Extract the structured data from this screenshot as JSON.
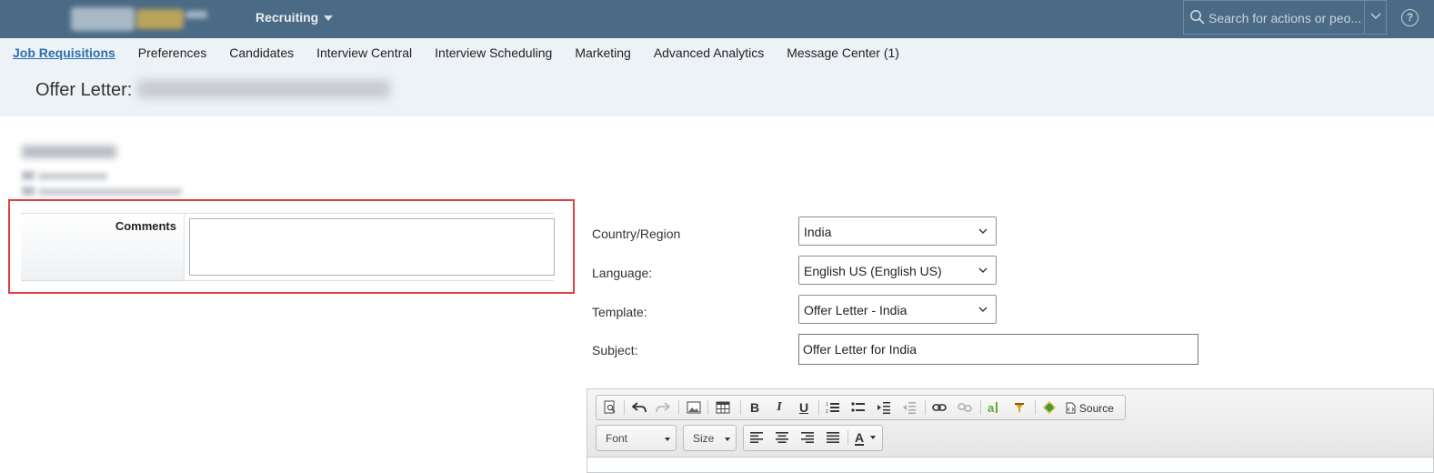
{
  "shell": {
    "module": "Recruiting",
    "search_placeholder": "Search for actions or peo...",
    "help_glyph": "?"
  },
  "tabs": [
    {
      "label": "Job Requisitions",
      "active": true
    },
    {
      "label": "Preferences",
      "active": false
    },
    {
      "label": "Candidates",
      "active": false
    },
    {
      "label": "Interview Central",
      "active": false
    },
    {
      "label": "Interview Scheduling",
      "active": false
    },
    {
      "label": "Marketing",
      "active": false
    },
    {
      "label": "Advanced Analytics",
      "active": false
    },
    {
      "label": "Message Center (1)",
      "active": false
    }
  ],
  "page": {
    "title_prefix": "Offer Letter:"
  },
  "comments": {
    "label": "Comments",
    "value": ""
  },
  "form": {
    "country_label": "Country/Region",
    "country_value": "India",
    "language_label": "Language:",
    "language_value": "English US (English US)",
    "template_label": "Template:",
    "template_value": "Offer Letter - India",
    "subject_label": "Subject:",
    "subject_value": "Offer Letter for India"
  },
  "editor": {
    "source_label": "Source",
    "font_label": "Font",
    "size_label": "Size",
    "bold_glyph": "B",
    "italic_glyph": "I",
    "underline_glyph": "U",
    "text_color_glyph": "A"
  },
  "colors": {
    "shell_bg": "#4b6a85",
    "subnav_bg": "#edf2f7",
    "active_tab": "#2b6eab",
    "highlight_border": "#e23f3f"
  }
}
